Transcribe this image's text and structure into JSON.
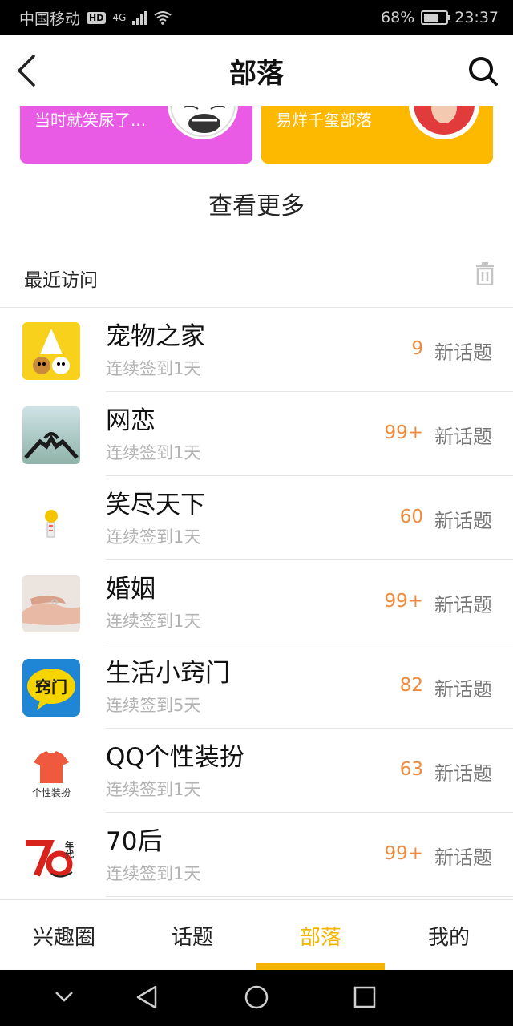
{
  "status_bar": {
    "carrier": "中国移动",
    "hd": "HD",
    "network": "4G",
    "battery": "68%",
    "battery_level": 0.68,
    "time": "23:37"
  },
  "header": {
    "title": "部落",
    "back_icon": "back-chevron-icon",
    "search_icon": "search-icon"
  },
  "cards": [
    {
      "text": "当时就笑尿了...",
      "color": "#e95be5"
    },
    {
      "text": "易烊千玺部落",
      "color": "#fdb900"
    }
  ],
  "view_more": "查看更多",
  "recent": {
    "label": "最近访问",
    "icon": "trash-icon"
  },
  "new_topic_suffix": "新话题",
  "items": [
    {
      "name": "宠物之家",
      "sub": "连续签到1天",
      "count": "9"
    },
    {
      "name": "网恋",
      "sub": "连续签到1天",
      "count": "99+"
    },
    {
      "name": "笑尽天下",
      "sub": "连续签到1天",
      "count": "60"
    },
    {
      "name": "婚姻",
      "sub": "连续签到1天",
      "count": "99+"
    },
    {
      "name": "生活小窍门",
      "sub": "连续签到5天",
      "count": "82",
      "icon_text": "窍门"
    },
    {
      "name": "QQ个性装扮",
      "sub": "连续签到1天",
      "count": "63",
      "icon_text": "个性装扮"
    },
    {
      "name": "70后",
      "sub": "连续签到1天",
      "count": "99+",
      "icon_text": "年代"
    }
  ],
  "tabs": [
    {
      "label": "兴趣圈"
    },
    {
      "label": "话题"
    },
    {
      "label": "部落",
      "active": true
    },
    {
      "label": "我的"
    }
  ],
  "accent_color": "#f5b400",
  "count_color": "#f08a3c"
}
